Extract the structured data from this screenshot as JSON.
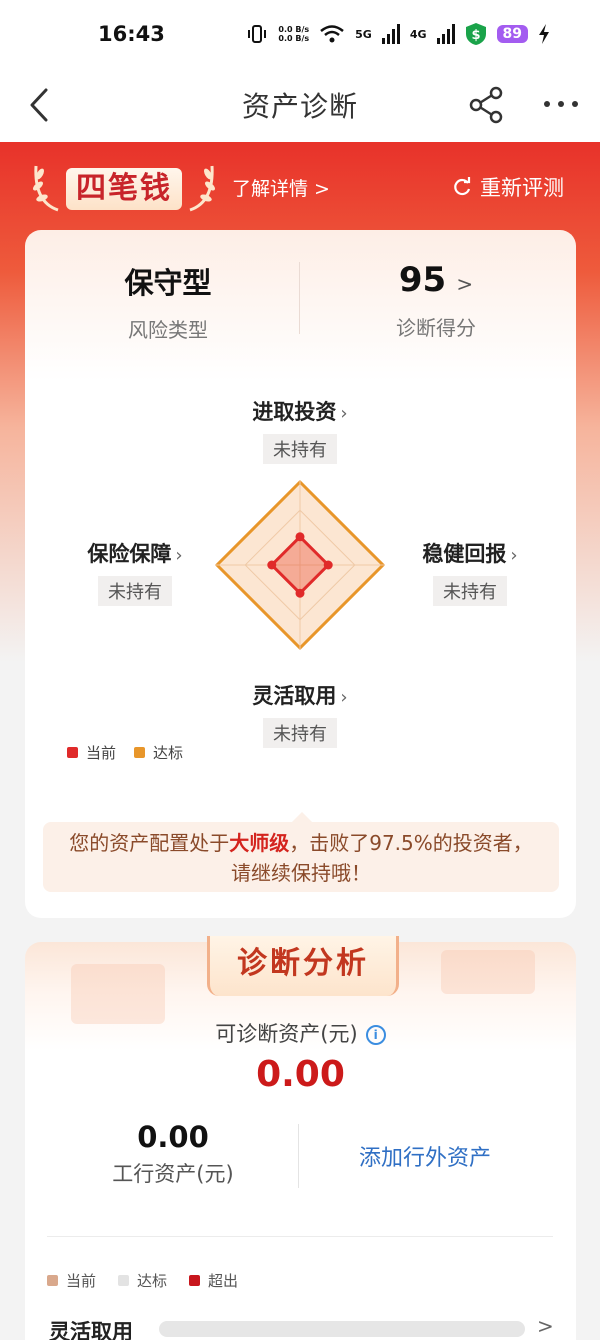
{
  "status_bar": {
    "time": "16:43",
    "net_up": "0.0 B/s",
    "net_down": "0.0 B/s",
    "signal1": "5G",
    "signal2": "4G",
    "battery": "89"
  },
  "nav": {
    "title": "资产诊断"
  },
  "hero": {
    "badge": "四笔钱",
    "learn_more": "了解详情 >",
    "reevaluate": "重新评测"
  },
  "summary": {
    "risk_value": "保守型",
    "risk_label": "风险类型",
    "score_value": "95",
    "score_chevron": ">",
    "score_label": "诊断得分"
  },
  "dimensions": {
    "top": {
      "name": "进取投资",
      "status": "未持有"
    },
    "left": {
      "name": "保险保障",
      "status": "未持有"
    },
    "right": {
      "name": "稳健回报",
      "status": "未持有"
    },
    "bottom": {
      "name": "灵活取用",
      "status": "未持有"
    }
  },
  "radar_legend": {
    "current": "当前",
    "target": "达标"
  },
  "radar_levels": {
    "current": 0.34,
    "target": 1.0
  },
  "message": {
    "prefix": "您的资产配置处于",
    "level": "大师级",
    "suffix": "，击败了97.5%的投资者，请继续保持哦！"
  },
  "analysis": {
    "banner": "诊断分析",
    "diagnosable_label": "可诊断资产(元)",
    "diagnosable_value": "0.00",
    "icbc_value": "0.00",
    "icbc_label": "工行资产(元)",
    "add_outside": "添加行外资产",
    "legend": {
      "current": "当前",
      "target": "达标",
      "exceed": "超出"
    },
    "row_label": "灵活取用",
    "row_chevron": ">"
  },
  "colors": {
    "brand_red": "#e8322a",
    "current": "#e02a2a",
    "target": "#e8962a",
    "legend_current": "#d9a88c",
    "legend_target": "#e3e3e3",
    "legend_exceed": "#c8161d",
    "link_blue": "#2f6fc4"
  }
}
